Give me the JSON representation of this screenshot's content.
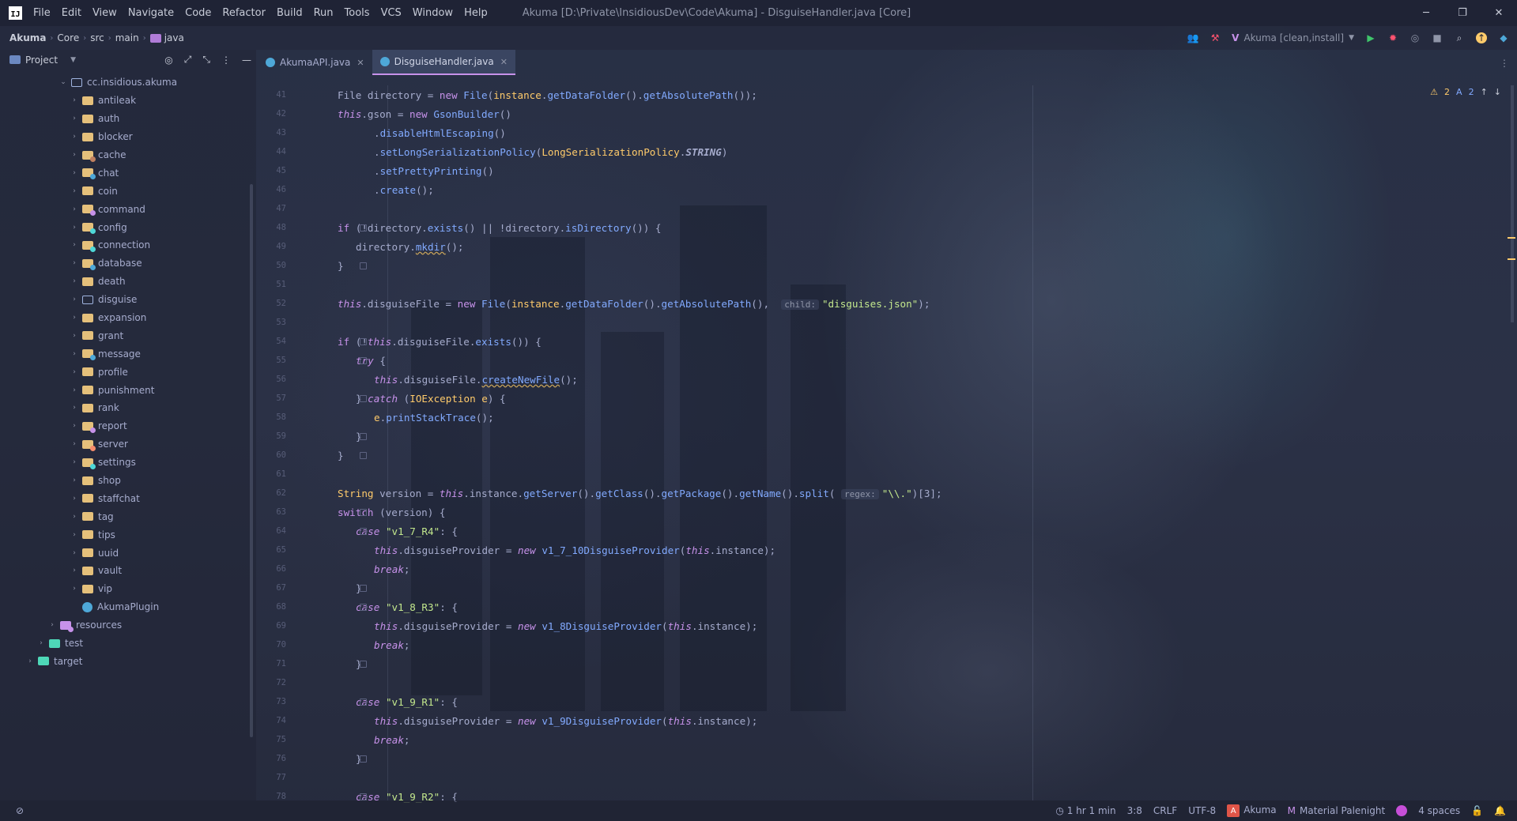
{
  "window": {
    "title": "Akuma [D:\\Private\\InsidiousDev\\Code\\Akuma] - DisguiseHandler.java [Core]",
    "logo": "IJ",
    "controls": [
      "─",
      "❐",
      "✕"
    ]
  },
  "menu": [
    "File",
    "Edit",
    "View",
    "Navigate",
    "Code",
    "Refactor",
    "Build",
    "Run",
    "Tools",
    "VCS",
    "Window",
    "Help"
  ],
  "breadcrumb": [
    "Akuma",
    "Core",
    "src",
    "main",
    "java"
  ],
  "run_config": "Akuma [clean,install]",
  "project_panel": {
    "title": "Project",
    "tree": [
      {
        "label": "cc.insidious.akuma",
        "depth": 0,
        "expanded": true,
        "type": "package"
      },
      {
        "label": "antileak",
        "depth": 1,
        "type": "folder"
      },
      {
        "label": "auth",
        "depth": 1,
        "type": "folder"
      },
      {
        "label": "blocker",
        "depth": 1,
        "type": "folder"
      },
      {
        "label": "cache",
        "depth": 1,
        "type": "folder",
        "dot": "#c08060"
      },
      {
        "label": "chat",
        "depth": 1,
        "type": "folder",
        "dot": "#4ea8d8"
      },
      {
        "label": "coin",
        "depth": 1,
        "type": "folder"
      },
      {
        "label": "command",
        "depth": 1,
        "type": "folder",
        "dot": "#c792ea"
      },
      {
        "label": "config",
        "depth": 1,
        "type": "folder",
        "dot": "#4ed8d8"
      },
      {
        "label": "connection",
        "depth": 1,
        "type": "folder",
        "dot": "#4ed8d8"
      },
      {
        "label": "database",
        "depth": 1,
        "type": "folder",
        "dot": "#4ea8d8"
      },
      {
        "label": "death",
        "depth": 1,
        "type": "folder"
      },
      {
        "label": "disguise",
        "depth": 1,
        "type": "folder-outline"
      },
      {
        "label": "expansion",
        "depth": 1,
        "type": "folder"
      },
      {
        "label": "grant",
        "depth": 1,
        "type": "folder"
      },
      {
        "label": "message",
        "depth": 1,
        "type": "folder",
        "dot": "#4ea8d8"
      },
      {
        "label": "profile",
        "depth": 1,
        "type": "folder"
      },
      {
        "label": "punishment",
        "depth": 1,
        "type": "folder"
      },
      {
        "label": "rank",
        "depth": 1,
        "type": "folder"
      },
      {
        "label": "report",
        "depth": 1,
        "type": "folder",
        "dot": "#c792ea"
      },
      {
        "label": "server",
        "depth": 1,
        "type": "folder",
        "dot": "#f78c6c"
      },
      {
        "label": "settings",
        "depth": 1,
        "type": "folder",
        "dot": "#4ed8d8"
      },
      {
        "label": "shop",
        "depth": 1,
        "type": "folder"
      },
      {
        "label": "staffchat",
        "depth": 1,
        "type": "folder"
      },
      {
        "label": "tag",
        "depth": 1,
        "type": "folder"
      },
      {
        "label": "tips",
        "depth": 1,
        "type": "folder"
      },
      {
        "label": "uuid",
        "depth": 1,
        "type": "folder"
      },
      {
        "label": "vault",
        "depth": 1,
        "type": "folder"
      },
      {
        "label": "vip",
        "depth": 1,
        "type": "folder"
      },
      {
        "label": "AkumaPlugin",
        "depth": 1,
        "type": "class"
      },
      {
        "label": "resources",
        "depth": -1,
        "type": "folder",
        "dot": "#c792ea",
        "color": "#c792ea"
      },
      {
        "label": "test",
        "depth": -2,
        "type": "folder",
        "color": "#4ed8b8"
      },
      {
        "label": "target",
        "depth": -3,
        "type": "folder",
        "color": "#4ed8b8"
      }
    ]
  },
  "tabs": [
    {
      "label": "AkumaAPI.java",
      "active": false
    },
    {
      "label": "DisguiseHandler.java",
      "active": true
    }
  ],
  "indicators": {
    "warnings": "2",
    "typos": "2"
  },
  "code_lines": [
    {
      "n": "41",
      "html": "File directory = <span class='kw'>new</span> <span class='m'>File</span>(<span class='ty'>instance</span>.<span class='m'>getDataFolder</span>().<span class='m'>getAbsolutePath</span>());",
      "indent": 0
    },
    {
      "n": "42",
      "html": "<span class='k'>this</span>.gson = <span class='kw'>new</span> <span class='m'>GsonBuilder</span>()",
      "indent": 0
    },
    {
      "n": "43",
      "html": ".<span class='m'>disableHtmlEscaping</span>()",
      "indent": 2
    },
    {
      "n": "44",
      "html": ".<span class='m'>setLongSerializationPolicy</span>(<span class='ty'>LongSerializationPolicy</span>.<span class='b'>STRING</span>)",
      "indent": 2
    },
    {
      "n": "45",
      "html": ".<span class='m'>setPrettyPrinting</span>()",
      "indent": 2
    },
    {
      "n": "46",
      "html": ".<span class='m'>create</span>();",
      "indent": 2
    },
    {
      "n": "47",
      "html": "",
      "indent": 0
    },
    {
      "n": "48",
      "html": "<span class='kw'>if</span> (!directory.<span class='m'>exists</span>() || !directory.<span class='m'>isDirectory</span>()) {",
      "indent": 0,
      "fold": true
    },
    {
      "n": "49",
      "html": "directory.<span class='m u'>mkdir</span>();",
      "indent": 1
    },
    {
      "n": "50",
      "html": "}",
      "indent": 0,
      "fold": true
    },
    {
      "n": "51",
      "html": "",
      "indent": 0
    },
    {
      "n": "52",
      "html": "<span class='k'>this</span>.disguiseFile = <span class='kw'>new</span> <span class='m'>File</span>(<span class='ty'>instance</span>.<span class='m'>getDataFolder</span>().<span class='m'>getAbsolutePath</span>(),  <span class='hint'>child:</span><span class='s'>\"disguises.json\"</span>);",
      "indent": 0
    },
    {
      "n": "53",
      "html": "",
      "indent": 0
    },
    {
      "n": "54",
      "html": "<span class='kw'>if</span> (!<span class='k'>this</span>.disguiseFile.<span class='m'>exists</span>()) {",
      "indent": 0,
      "fold": true
    },
    {
      "n": "55",
      "html": "<span class='k'>try</span> {",
      "indent": 1,
      "fold": true
    },
    {
      "n": "56",
      "html": "<span class='k'>this</span>.disguiseFile.<span class='m u'>createNewFile</span>();",
      "indent": 2
    },
    {
      "n": "57",
      "html": "} <span class='k'>catch</span> (<span class='ty'>IOException</span> <span class='ty'>e</span>) {",
      "indent": 1,
      "fold": true
    },
    {
      "n": "58",
      "html": "<span class='ty'>e</span>.<span class='m'>printStackTrace</span>();",
      "indent": 2
    },
    {
      "n": "59",
      "html": "}",
      "indent": 1,
      "fold": true
    },
    {
      "n": "60",
      "html": "}",
      "indent": 0,
      "fold": true
    },
    {
      "n": "61",
      "html": "",
      "indent": 0
    },
    {
      "n": "62",
      "html": "<span class='ty'>String</span> version = <span class='k'>this</span>.instance.<span class='m'>getServer</span>().<span class='m'>getClass</span>().<span class='m'>getPackage</span>().<span class='m'>getName</span>().<span class='m'>split</span>( <span class='hint'>regex:</span><span class='s'>\"\\\\.\"</span>)[3];",
      "indent": 0
    },
    {
      "n": "63",
      "html": "<span class='kw'>switch</span> (version) {",
      "indent": 0,
      "fold": true
    },
    {
      "n": "64",
      "html": "<span class='k'>case</span> <span class='s'>\"v1_7_R4\"</span>: {",
      "indent": 1,
      "fold": true
    },
    {
      "n": "65",
      "html": "<span class='k'>this</span>.disguiseProvider = <span class='k'>new</span> <span class='m'>v1_7_10DisguiseProvider</span>(<span class='k'>this</span>.instance);",
      "indent": 2
    },
    {
      "n": "66",
      "html": "<span class='k'>break</span>;",
      "indent": 2
    },
    {
      "n": "67",
      "html": "}",
      "indent": 1,
      "fold": true
    },
    {
      "n": "68",
      "html": "<span class='k'>case</span> <span class='s'>\"v1_8_R3\"</span>: {",
      "indent": 1,
      "fold": true
    },
    {
      "n": "69",
      "html": "<span class='k'>this</span>.disguiseProvider = <span class='k'>new</span> <span class='m'>v1_8DisguiseProvider</span>(<span class='k'>this</span>.instance);",
      "indent": 2
    },
    {
      "n": "70",
      "html": "<span class='k'>break</span>;",
      "indent": 2
    },
    {
      "n": "71",
      "html": "}",
      "indent": 1,
      "fold": true
    },
    {
      "n": "72",
      "html": "",
      "indent": 0
    },
    {
      "n": "73",
      "html": "<span class='k'>case</span> <span class='s'>\"v1_9_R1\"</span>: {",
      "indent": 1,
      "fold": true
    },
    {
      "n": "74",
      "html": "<span class='k'>this</span>.disguiseProvider = <span class='k'>new</span> <span class='m'>v1_9DisguiseProvider</span>(<span class='k'>this</span>.instance);",
      "indent": 2
    },
    {
      "n": "75",
      "html": "<span class='k'>break</span>;",
      "indent": 2
    },
    {
      "n": "76",
      "html": "}",
      "indent": 1,
      "fold": true
    },
    {
      "n": "77",
      "html": "",
      "indent": 0
    },
    {
      "n": "78",
      "html": "<span class='k'>case</span> <span class='s'>\"v1_9_R2\"</span>: {",
      "indent": 1,
      "fold": true
    }
  ],
  "status": {
    "time": "1 hr 1 min",
    "position": "3:8",
    "line_sep": "CRLF",
    "encoding": "UTF-8",
    "project": "Akuma",
    "theme": "Material Palenight",
    "indent": "4 spaces"
  },
  "colors": {
    "accent": "#c792ea",
    "warning": "#ffcb6b",
    "folder": "#e5c07b"
  }
}
